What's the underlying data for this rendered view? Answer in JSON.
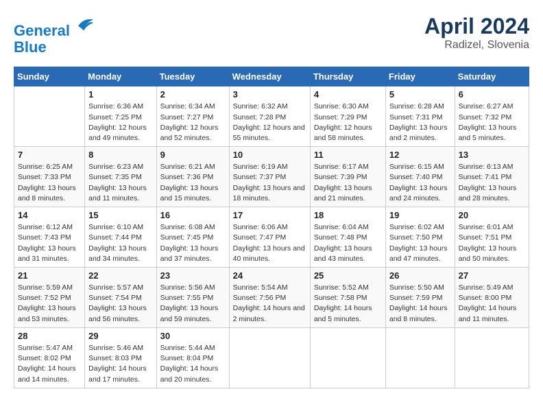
{
  "header": {
    "logo_line1": "General",
    "logo_line2": "Blue",
    "month_title": "April 2024",
    "location": "Radizel, Slovenia"
  },
  "weekdays": [
    "Sunday",
    "Monday",
    "Tuesday",
    "Wednesday",
    "Thursday",
    "Friday",
    "Saturday"
  ],
  "weeks": [
    [
      {
        "day": "",
        "sunrise": "",
        "sunset": "",
        "daylight": ""
      },
      {
        "day": "1",
        "sunrise": "Sunrise: 6:36 AM",
        "sunset": "Sunset: 7:25 PM",
        "daylight": "Daylight: 12 hours and 49 minutes."
      },
      {
        "day": "2",
        "sunrise": "Sunrise: 6:34 AM",
        "sunset": "Sunset: 7:27 PM",
        "daylight": "Daylight: 12 hours and 52 minutes."
      },
      {
        "day": "3",
        "sunrise": "Sunrise: 6:32 AM",
        "sunset": "Sunset: 7:28 PM",
        "daylight": "Daylight: 12 hours and 55 minutes."
      },
      {
        "day": "4",
        "sunrise": "Sunrise: 6:30 AM",
        "sunset": "Sunset: 7:29 PM",
        "daylight": "Daylight: 12 hours and 58 minutes."
      },
      {
        "day": "5",
        "sunrise": "Sunrise: 6:28 AM",
        "sunset": "Sunset: 7:31 PM",
        "daylight": "Daylight: 13 hours and 2 minutes."
      },
      {
        "day": "6",
        "sunrise": "Sunrise: 6:27 AM",
        "sunset": "Sunset: 7:32 PM",
        "daylight": "Daylight: 13 hours and 5 minutes."
      }
    ],
    [
      {
        "day": "7",
        "sunrise": "Sunrise: 6:25 AM",
        "sunset": "Sunset: 7:33 PM",
        "daylight": "Daylight: 13 hours and 8 minutes."
      },
      {
        "day": "8",
        "sunrise": "Sunrise: 6:23 AM",
        "sunset": "Sunset: 7:35 PM",
        "daylight": "Daylight: 13 hours and 11 minutes."
      },
      {
        "day": "9",
        "sunrise": "Sunrise: 6:21 AM",
        "sunset": "Sunset: 7:36 PM",
        "daylight": "Daylight: 13 hours and 15 minutes."
      },
      {
        "day": "10",
        "sunrise": "Sunrise: 6:19 AM",
        "sunset": "Sunset: 7:37 PM",
        "daylight": "Daylight: 13 hours and 18 minutes."
      },
      {
        "day": "11",
        "sunrise": "Sunrise: 6:17 AM",
        "sunset": "Sunset: 7:39 PM",
        "daylight": "Daylight: 13 hours and 21 minutes."
      },
      {
        "day": "12",
        "sunrise": "Sunrise: 6:15 AM",
        "sunset": "Sunset: 7:40 PM",
        "daylight": "Daylight: 13 hours and 24 minutes."
      },
      {
        "day": "13",
        "sunrise": "Sunrise: 6:13 AM",
        "sunset": "Sunset: 7:41 PM",
        "daylight": "Daylight: 13 hours and 28 minutes."
      }
    ],
    [
      {
        "day": "14",
        "sunrise": "Sunrise: 6:12 AM",
        "sunset": "Sunset: 7:43 PM",
        "daylight": "Daylight: 13 hours and 31 minutes."
      },
      {
        "day": "15",
        "sunrise": "Sunrise: 6:10 AM",
        "sunset": "Sunset: 7:44 PM",
        "daylight": "Daylight: 13 hours and 34 minutes."
      },
      {
        "day": "16",
        "sunrise": "Sunrise: 6:08 AM",
        "sunset": "Sunset: 7:45 PM",
        "daylight": "Daylight: 13 hours and 37 minutes."
      },
      {
        "day": "17",
        "sunrise": "Sunrise: 6:06 AM",
        "sunset": "Sunset: 7:47 PM",
        "daylight": "Daylight: 13 hours and 40 minutes."
      },
      {
        "day": "18",
        "sunrise": "Sunrise: 6:04 AM",
        "sunset": "Sunset: 7:48 PM",
        "daylight": "Daylight: 13 hours and 43 minutes."
      },
      {
        "day": "19",
        "sunrise": "Sunrise: 6:02 AM",
        "sunset": "Sunset: 7:50 PM",
        "daylight": "Daylight: 13 hours and 47 minutes."
      },
      {
        "day": "20",
        "sunrise": "Sunrise: 6:01 AM",
        "sunset": "Sunset: 7:51 PM",
        "daylight": "Daylight: 13 hours and 50 minutes."
      }
    ],
    [
      {
        "day": "21",
        "sunrise": "Sunrise: 5:59 AM",
        "sunset": "Sunset: 7:52 PM",
        "daylight": "Daylight: 13 hours and 53 minutes."
      },
      {
        "day": "22",
        "sunrise": "Sunrise: 5:57 AM",
        "sunset": "Sunset: 7:54 PM",
        "daylight": "Daylight: 13 hours and 56 minutes."
      },
      {
        "day": "23",
        "sunrise": "Sunrise: 5:56 AM",
        "sunset": "Sunset: 7:55 PM",
        "daylight": "Daylight: 13 hours and 59 minutes."
      },
      {
        "day": "24",
        "sunrise": "Sunrise: 5:54 AM",
        "sunset": "Sunset: 7:56 PM",
        "daylight": "Daylight: 14 hours and 2 minutes."
      },
      {
        "day": "25",
        "sunrise": "Sunrise: 5:52 AM",
        "sunset": "Sunset: 7:58 PM",
        "daylight": "Daylight: 14 hours and 5 minutes."
      },
      {
        "day": "26",
        "sunrise": "Sunrise: 5:50 AM",
        "sunset": "Sunset: 7:59 PM",
        "daylight": "Daylight: 14 hours and 8 minutes."
      },
      {
        "day": "27",
        "sunrise": "Sunrise: 5:49 AM",
        "sunset": "Sunset: 8:00 PM",
        "daylight": "Daylight: 14 hours and 11 minutes."
      }
    ],
    [
      {
        "day": "28",
        "sunrise": "Sunrise: 5:47 AM",
        "sunset": "Sunset: 8:02 PM",
        "daylight": "Daylight: 14 hours and 14 minutes."
      },
      {
        "day": "29",
        "sunrise": "Sunrise: 5:46 AM",
        "sunset": "Sunset: 8:03 PM",
        "daylight": "Daylight: 14 hours and 17 minutes."
      },
      {
        "day": "30",
        "sunrise": "Sunrise: 5:44 AM",
        "sunset": "Sunset: 8:04 PM",
        "daylight": "Daylight: 14 hours and 20 minutes."
      },
      {
        "day": "",
        "sunrise": "",
        "sunset": "",
        "daylight": ""
      },
      {
        "day": "",
        "sunrise": "",
        "sunset": "",
        "daylight": ""
      },
      {
        "day": "",
        "sunrise": "",
        "sunset": "",
        "daylight": ""
      },
      {
        "day": "",
        "sunrise": "",
        "sunset": "",
        "daylight": ""
      }
    ]
  ]
}
